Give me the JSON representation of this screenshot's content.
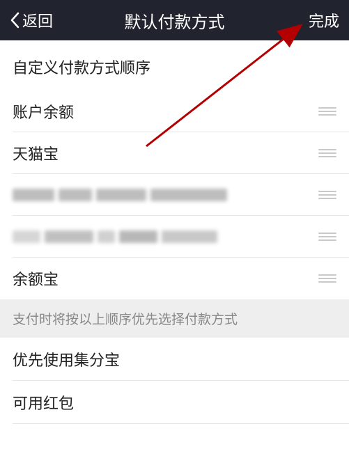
{
  "header": {
    "back_label": "返回",
    "title": "默认付款方式",
    "done_label": "完成"
  },
  "section_header": "自定义付款方式顺序",
  "payment_items": [
    {
      "label": "账户余额"
    },
    {
      "label": "天猫宝"
    },
    {
      "label": ""
    },
    {
      "label": ""
    },
    {
      "label": "余额宝"
    }
  ],
  "hint": "支付时将按以上顺序优先选择付款方式",
  "extra_items": [
    {
      "label": "优先使用集分宝"
    },
    {
      "label": "可用红包"
    }
  ]
}
